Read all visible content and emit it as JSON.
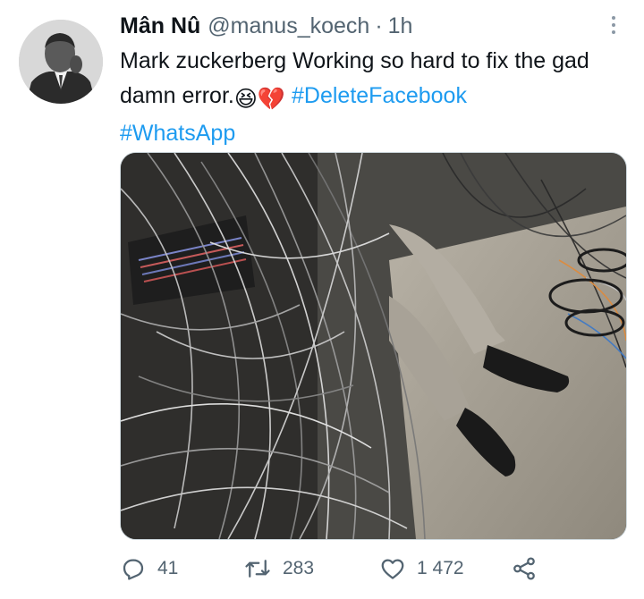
{
  "tweet": {
    "author_name": "Mân Nû",
    "author_handle": "@manus_koech",
    "separator": "·",
    "time": "1h",
    "text_main": "Mark zuckerberg Working so hard to fix the gad damn error.",
    "emoji_1": "😆",
    "emoji_2": "💔",
    "hashtag_1": "#DeleteFacebook",
    "hashtag_2": "#WhatsApp",
    "reply_count": "41",
    "retweet_count": "283",
    "like_count": "1 472"
  },
  "colors": {
    "link": "#1d9bf0",
    "secondary_text": "#536471",
    "primary_text": "#0f1419"
  },
  "icons": [
    "more-icon",
    "reply-icon",
    "retweet-icon",
    "like-icon",
    "share-icon"
  ]
}
